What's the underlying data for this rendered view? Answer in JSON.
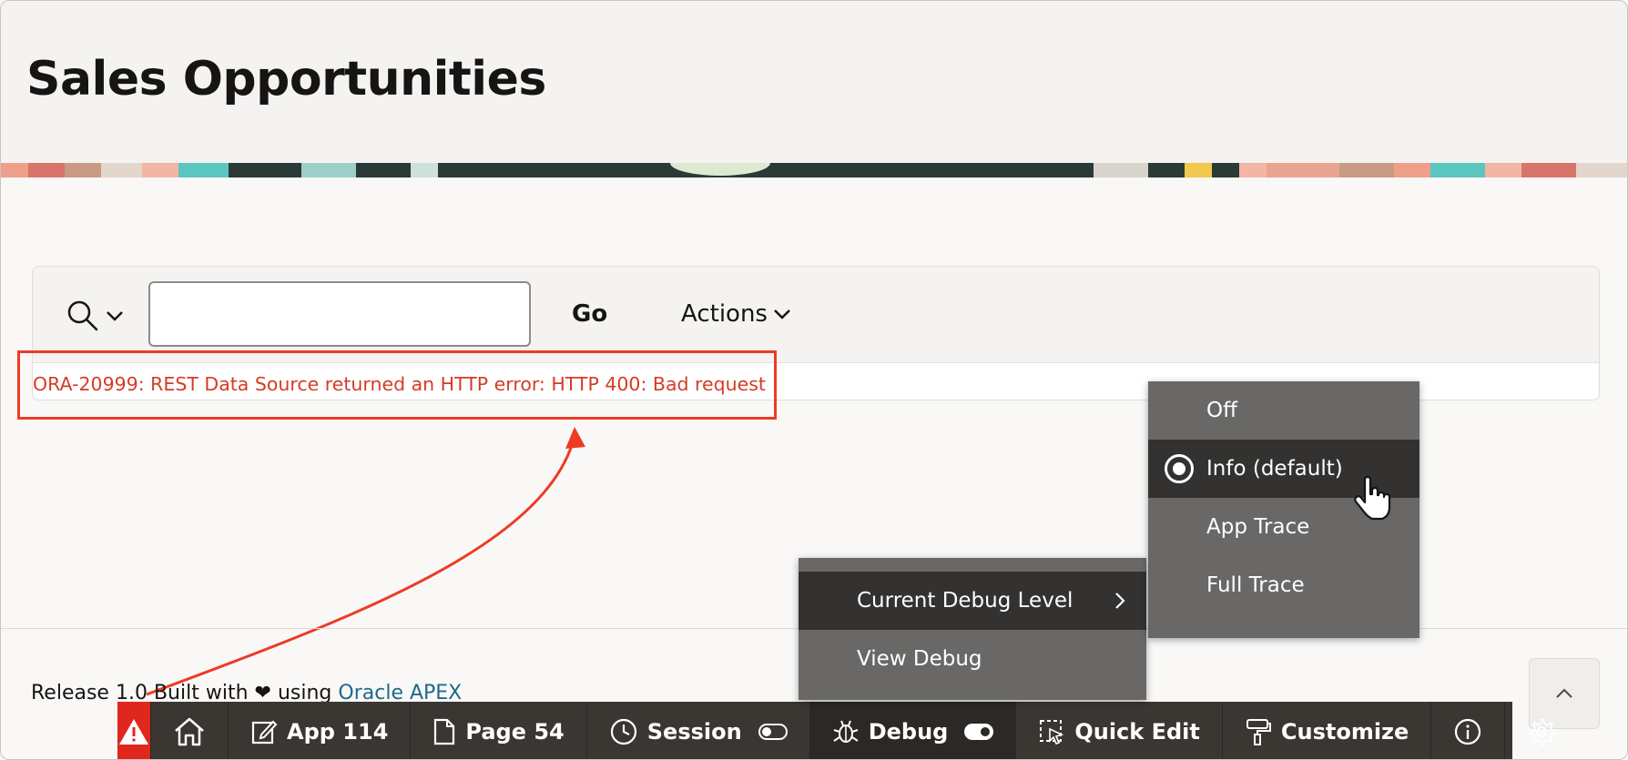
{
  "page": {
    "title": "Sales Opportunities"
  },
  "toolbar": {
    "search_value": "",
    "go_label": "Go",
    "actions_label": "Actions"
  },
  "report": {
    "error_message": "ORA-20999: REST Data Source returned an HTTP error: HTTP 400: Bad request"
  },
  "footer": {
    "release": "Release 1.0",
    "built_with": "Built with",
    "using": "using",
    "apex_link": "Oracle APEX"
  },
  "devbar": {
    "app": "App 114",
    "page": "Page 54",
    "session": "Session",
    "debug": "Debug",
    "quick_edit": "Quick Edit",
    "customize": "Customize"
  },
  "debug_menu": {
    "items": [
      {
        "label": "Current Debug Level"
      },
      {
        "label": "View Debug"
      }
    ]
  },
  "level_menu": {
    "items": [
      {
        "label": "Off"
      },
      {
        "label": "Info (default)",
        "selected": true
      },
      {
        "label": "App Trace"
      },
      {
        "label": "Full Trace"
      }
    ]
  },
  "colors": {
    "error": "#d63b25",
    "annotation": "#ee3b24",
    "devbar": "#3a3632",
    "alert": "#e0271d",
    "menu": "#696866",
    "menu_highlight": "#343230",
    "link": "#1d6a8a"
  }
}
